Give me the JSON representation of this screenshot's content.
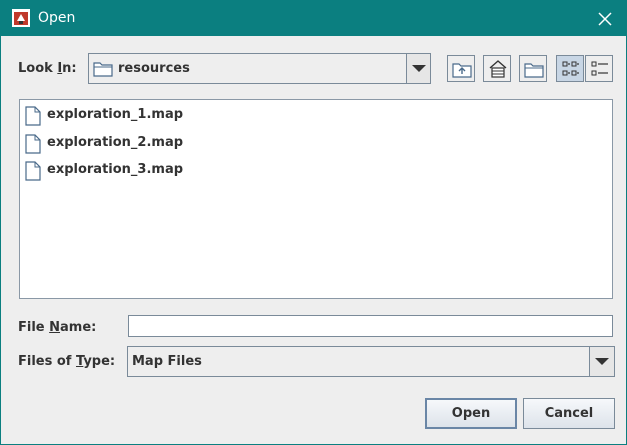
{
  "window": {
    "title": "Open"
  },
  "look_in": {
    "label_prefix": "Look ",
    "label_mnemonic": "I",
    "label_suffix": "n:",
    "current_folder": "resources"
  },
  "toolbar": {
    "icons": [
      "up-folder-icon",
      "home-icon",
      "new-folder-icon",
      "list-view-icon",
      "details-view-icon"
    ],
    "active_view": "list"
  },
  "files": [
    {
      "name": "exploration_1.map",
      "icon": "file-icon"
    },
    {
      "name": "exploration_2.map",
      "icon": "file-icon"
    },
    {
      "name": "exploration_3.map",
      "icon": "file-icon"
    }
  ],
  "file_name": {
    "label_prefix": "File ",
    "label_mnemonic": "N",
    "label_suffix": "ame:",
    "value": ""
  },
  "file_type": {
    "label_prefix": "Files of ",
    "label_mnemonic": "T",
    "label_suffix": "ype:",
    "selected": "Map Files"
  },
  "buttons": {
    "open": "Open",
    "cancel": "Cancel"
  },
  "colors": {
    "titlebar": "#0b7f80",
    "background": "#eeeeee",
    "border": "#7a8a99"
  }
}
